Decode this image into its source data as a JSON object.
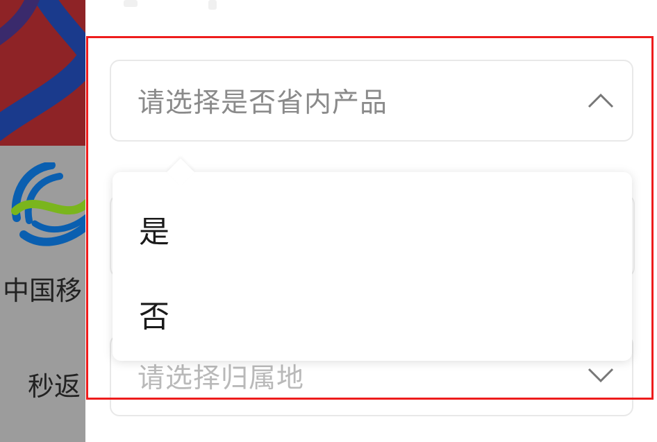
{
  "left": {
    "brand_text": "中国移",
    "cta_text": "秒返"
  },
  "form": {
    "province_select": {
      "placeholder": "请选择是否省内产品",
      "state": "expanded",
      "options": [
        "是",
        "否"
      ]
    },
    "region_select": {
      "placeholder": "请选择归属地"
    }
  },
  "colors": {
    "highlight": "#ee1c1c",
    "placeholder_text": "#8a8a8a",
    "option_text": "#1a1a1a",
    "brand_blue": "#0a5fb0",
    "brand_green": "#7ab51d"
  },
  "icons": {
    "province_chevron": "chevron-up-icon",
    "region_chevron": "chevron-down-icon"
  }
}
